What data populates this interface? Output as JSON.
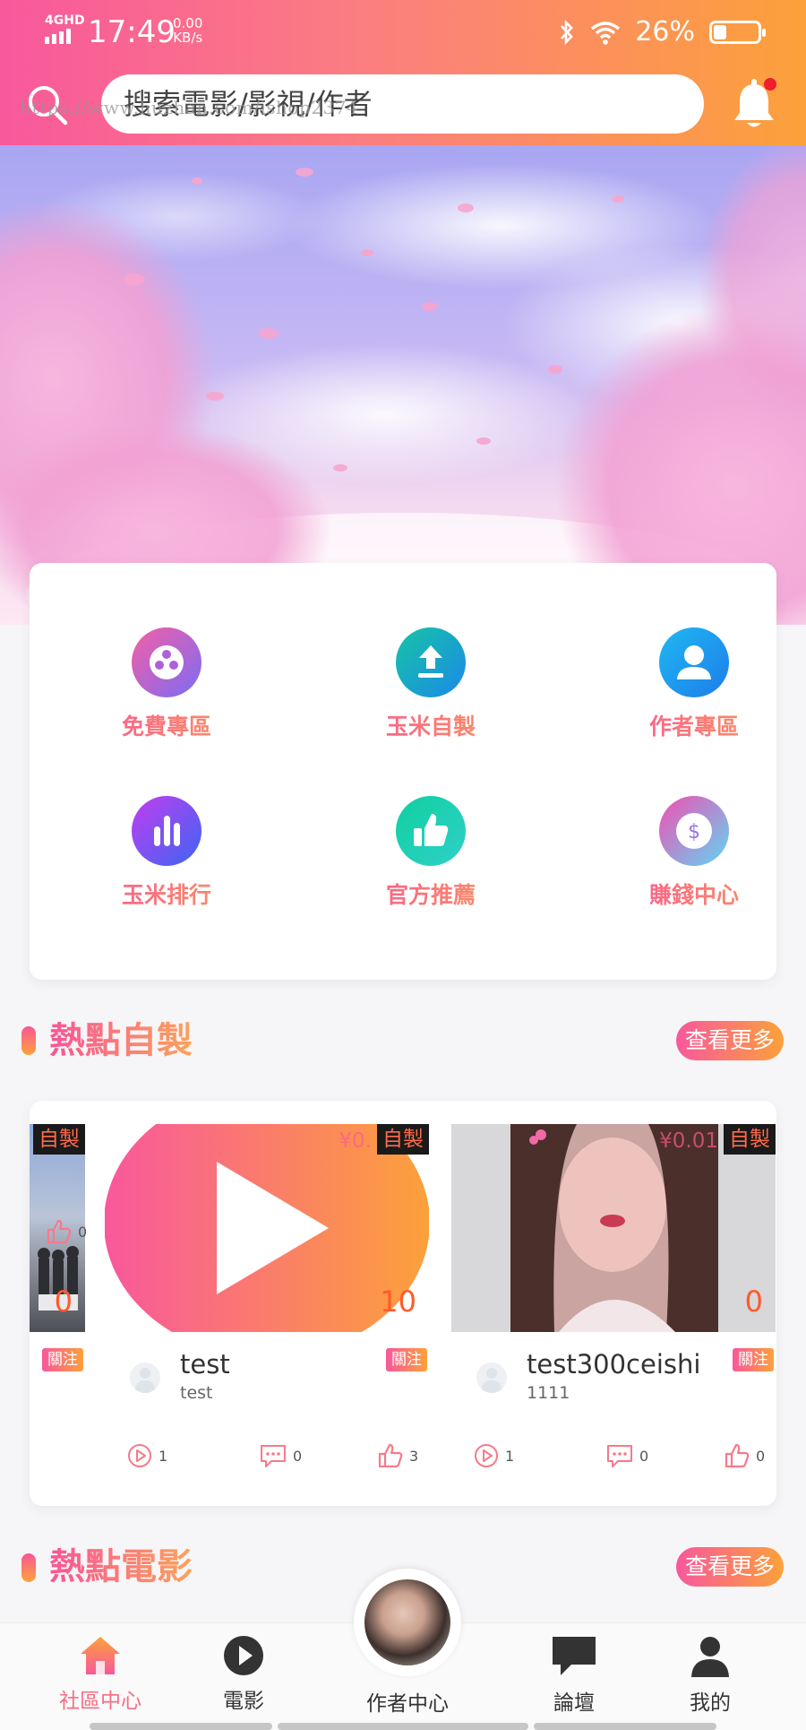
{
  "status_bar": {
    "network": "4GHD",
    "time": "17:49",
    "speed_value": "0.00",
    "speed_unit": "KB/s",
    "battery_percent": "26%",
    "battery_level": 0.26
  },
  "search": {
    "placeholder": "搜索電影/影視/作者",
    "watermark": "https://www.huzhan.com/ishop2374"
  },
  "banner": {
    "slide_count": 1,
    "active_slide": 0
  },
  "quick_menu": [
    {
      "label": "免費專區",
      "icon": "film-reel-icon",
      "color_a": "#f45fa5",
      "color_b": "#7b6cf5"
    },
    {
      "label": "玉米自製",
      "icon": "upload-icon",
      "color_a": "#16c4a6",
      "color_b": "#1b89e8"
    },
    {
      "label": "作者專區",
      "icon": "user-icon",
      "color_a": "#1fb8f2",
      "color_b": "#1e7de9"
    },
    {
      "label": "玉米排行",
      "icon": "bar-chart-icon",
      "color_a": "#c13ef0",
      "color_b": "#3c65f2"
    },
    {
      "label": "官方推薦",
      "icon": "thumbs-up-icon",
      "color_a": "#10cf9f",
      "color_b": "#2fd1c9"
    },
    {
      "label": "賺錢中心",
      "icon": "dollar-coin-icon",
      "color_a": "#f24fb0",
      "color_b": "#5fd6f5"
    }
  ],
  "section_hot_original": {
    "title": "熱點自製",
    "more_label": "查看更多"
  },
  "videos": [
    {
      "tag": "自製",
      "price": "",
      "count": "0",
      "follow": "",
      "name": "",
      "sub": "",
      "likes": "0",
      "plays": "",
      "comments": ""
    },
    {
      "tag": "自製",
      "price": "¥0.",
      "count": "10",
      "follow": "關注",
      "name": "test",
      "sub": "test",
      "likes": "3",
      "plays": "1",
      "comments": "0"
    },
    {
      "tag": "自製",
      "price": "¥0.01",
      "count": "0",
      "follow": "關注",
      "name": "test300ceishi",
      "sub": "1111",
      "likes": "0",
      "plays": "1",
      "comments": "0"
    }
  ],
  "left_partial_follow": "關注",
  "section_hot_movie": {
    "title": "熱點電影",
    "more_label": "查看更多"
  },
  "bottom_nav": {
    "items": [
      "社區中心",
      "電影",
      "作者中心",
      "論壇",
      "我的"
    ],
    "active_index": 0
  },
  "colors": {
    "brand_pink": "#f8589c",
    "brand_orange": "#fca13a",
    "tag_text": "#ff6b4c"
  }
}
